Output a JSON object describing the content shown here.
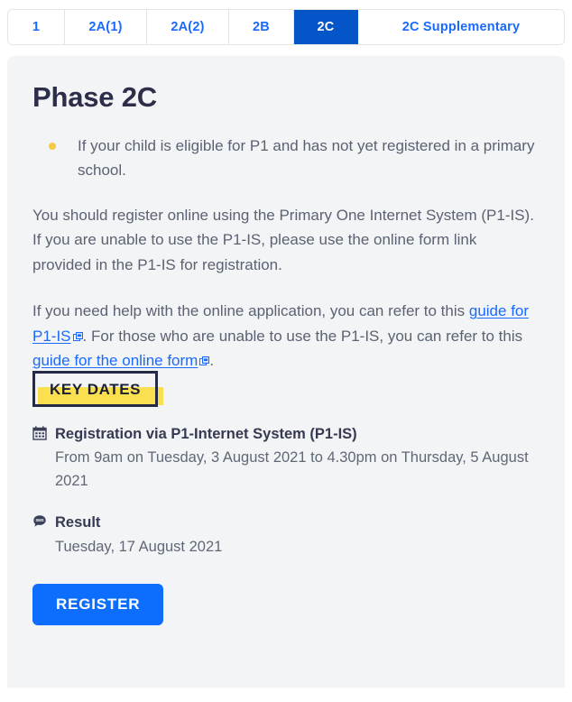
{
  "tabs": [
    {
      "label": "1",
      "active": false
    },
    {
      "label": "2A(1)",
      "active": false
    },
    {
      "label": "2A(2)",
      "active": false
    },
    {
      "label": "2B",
      "active": false
    },
    {
      "label": "2C",
      "active": true
    },
    {
      "label": "2C Supplementary",
      "active": false
    }
  ],
  "page": {
    "title": "Phase 2C"
  },
  "eligibility": {
    "items": [
      "If your child is eligible for P1 and has not yet registered in a primary school."
    ]
  },
  "paragraphs": {
    "registration": "You should register online using the Primary One Internet System (P1-IS). If you are unable to use the P1-IS, please use the online form link provided in the P1-IS for registration.",
    "help_pre": "If you need help with the online application, you can refer to this ",
    "help_link1": "guide for P1-IS",
    "help_mid": ". For those who are unable to use the P1-IS, you can refer to this ",
    "help_link2": "guide for the online form",
    "help_post": "."
  },
  "key_dates": {
    "badge": "KEY DATES",
    "entries": [
      {
        "icon": "calendar-icon",
        "title": "Registration via P1-Internet System (P1-IS)",
        "detail": "From 9am on Tuesday, 3 August 2021 to 4.30pm on Thursday, 5 August 2021"
      },
      {
        "icon": "sms-bubble-icon",
        "title": "Result",
        "detail": "Tuesday, 17 August 2021"
      }
    ]
  },
  "actions": {
    "register_label": "REGISTER"
  },
  "colors": {
    "tab_active_bg": "#0355c8",
    "link_blue": "#1a6aff",
    "button_blue": "#0d6efd",
    "highlight_yellow": "#fae04f",
    "bullet_yellow": "#f7c948",
    "heading_navy": "#2c2e4a",
    "panel_bg": "#f2f4f5"
  }
}
